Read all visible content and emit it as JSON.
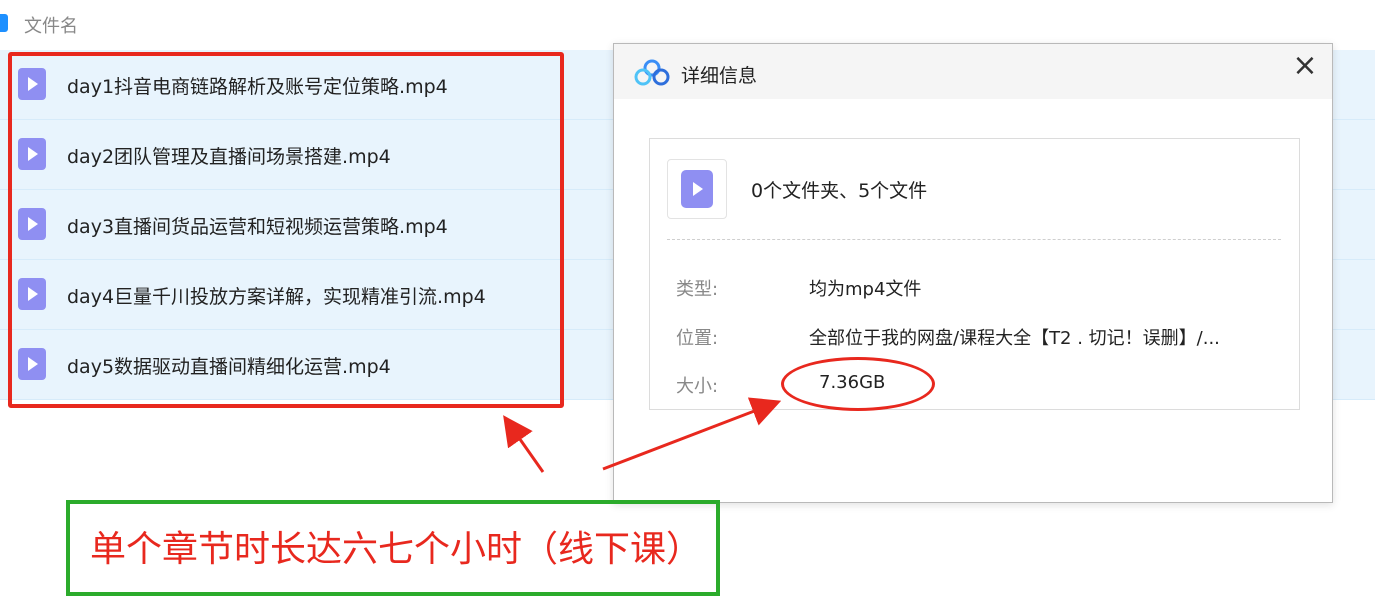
{
  "list": {
    "column_header": "文件名",
    "files": [
      {
        "name": "day1抖音电商链路解析及账号定位策略.mp4",
        "icon": "video-file-icon"
      },
      {
        "name": "day2团队管理及直播间场景搭建.mp4",
        "icon": "video-file-icon"
      },
      {
        "name": "day3直播间货品运营和短视频运营策略.mp4",
        "icon": "video-file-icon"
      },
      {
        "name": "day4巨量千川投放方案详解，实现精准引流.mp4",
        "icon": "video-file-icon"
      },
      {
        "name": "day5数据驱动直播间精细化运营.mp4",
        "icon": "video-file-icon"
      }
    ]
  },
  "dialog": {
    "title": "详细信息",
    "summary": "0个文件夹、5个文件",
    "type_label": "类型:",
    "type_value": "均为mp4文件",
    "location_label": "位置:",
    "location_value": "全部位于我的网盘/课程大全【T2 . 切记！误删】/...",
    "size_label": "大小:",
    "size_value": "7.36GB",
    "close_icon": "close-icon"
  },
  "annotation": {
    "text": "单个章节时长达六七个小时（线下课）"
  },
  "colors": {
    "row_bg": "#e8f4fd",
    "file_icon": "#8f8ff2",
    "annotation_red": "#e8281e",
    "annotation_green": "#2bab2b",
    "header_gray": "#f5f5f5"
  }
}
